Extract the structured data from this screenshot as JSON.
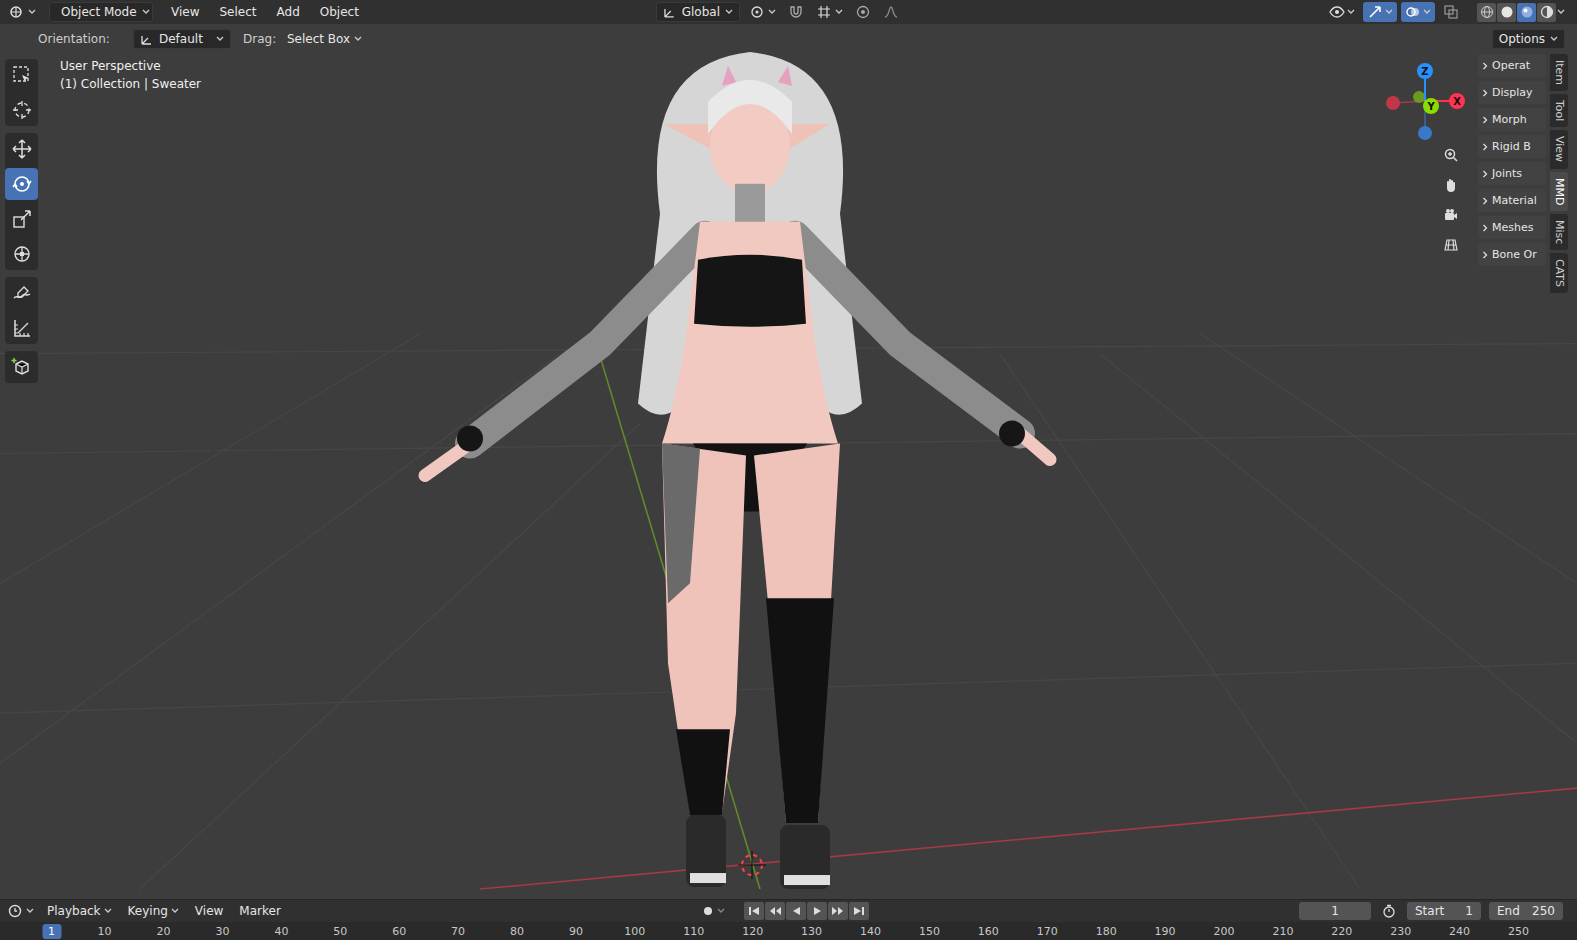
{
  "header": {
    "mode": "Object Mode",
    "menus": [
      "View",
      "Select",
      "Add",
      "Object"
    ],
    "orientation": "Global",
    "toggles": [
      {
        "kind": "visibility",
        "on": false
      },
      {
        "kind": "gizmos",
        "on": true
      },
      {
        "kind": "overlays",
        "on": true
      },
      {
        "kind": "xray",
        "on": false
      }
    ],
    "shading": [
      {
        "kind": "wireframe",
        "selected": false
      },
      {
        "kind": "solid",
        "selected": false
      },
      {
        "kind": "material",
        "selected": true
      },
      {
        "kind": "rendered",
        "selected": false
      }
    ]
  },
  "tool_settings": {
    "orientation_label": "Orientation:",
    "orientation": "Default",
    "drag_label": "Drag:",
    "drag": "Select Box",
    "options": "Options"
  },
  "viewport": {
    "view": "User Perspective",
    "context": "(1) Collection | Sweater"
  },
  "tool_groups": [
    [
      {
        "kind": "select",
        "selected": false
      },
      {
        "kind": "cursor",
        "selected": false
      }
    ],
    [
      {
        "kind": "move",
        "selected": false
      },
      {
        "kind": "rotate",
        "selected": true
      },
      {
        "kind": "scale",
        "selected": false
      },
      {
        "kind": "transform",
        "selected": false
      }
    ],
    [
      {
        "kind": "annotate",
        "selected": false
      },
      {
        "kind": "measure",
        "selected": false
      }
    ],
    [
      {
        "kind": "add-cube",
        "selected": false
      }
    ]
  ],
  "gizmo": {
    "x": "X",
    "y": "Y",
    "z": "Z"
  },
  "side_panels": [
    {
      "label": "Operat",
      "expanded": false
    },
    {
      "label": "Display",
      "expanded": false
    },
    {
      "label": "Morph",
      "expanded": false
    },
    {
      "label": "Rigid B",
      "expanded": false
    },
    {
      "label": "Joints",
      "expanded": false
    },
    {
      "label": "Material",
      "expanded": false
    },
    {
      "label": "Meshes",
      "expanded": false
    },
    {
      "label": "Bone Or",
      "expanded": false
    }
  ],
  "side_tabs": [
    {
      "label": "Item",
      "selected": false
    },
    {
      "label": "Tool",
      "selected": false
    },
    {
      "label": "View",
      "selected": false
    },
    {
      "label": "MMD",
      "selected": true
    },
    {
      "label": "Misc",
      "selected": false
    },
    {
      "label": "CATS",
      "selected": false
    }
  ],
  "timeline": {
    "menus": [
      "Playback",
      "Keying",
      "View",
      "Marker"
    ],
    "auto_key": {
      "on": false
    },
    "controls": [
      "jump-start",
      "prev-key",
      "play-reverse",
      "play",
      "next-key",
      "jump-end"
    ],
    "frame": "1",
    "start_label": "Start",
    "start": "1",
    "end_label": "End",
    "end": "250"
  },
  "ruler": {
    "ticks": [
      {
        "label": "1",
        "selected": true
      },
      {
        "label": "10",
        "selected": false
      },
      {
        "label": "20",
        "selected": false
      },
      {
        "label": "30",
        "selected": false
      },
      {
        "label": "40",
        "selected": false
      },
      {
        "label": "50",
        "selected": false
      },
      {
        "label": "60",
        "selected": false
      },
      {
        "label": "70",
        "selected": false
      },
      {
        "label": "80",
        "selected": false
      },
      {
        "label": "90",
        "selected": false
      },
      {
        "label": "100",
        "selected": false
      },
      {
        "label": "110",
        "selected": false
      },
      {
        "label": "120",
        "selected": false
      },
      {
        "label": "130",
        "selected": false
      },
      {
        "label": "140",
        "selected": false
      },
      {
        "label": "150",
        "selected": false
      },
      {
        "label": "160",
        "selected": false
      },
      {
        "label": "170",
        "selected": false
      },
      {
        "label": "180",
        "selected": false
      },
      {
        "label": "190",
        "selected": false
      },
      {
        "label": "200",
        "selected": false
      },
      {
        "label": "210",
        "selected": false
      },
      {
        "label": "220",
        "selected": false
      },
      {
        "label": "230",
        "selected": false
      },
      {
        "label": "240",
        "selected": false
      },
      {
        "label": "250",
        "selected": false
      }
    ]
  }
}
